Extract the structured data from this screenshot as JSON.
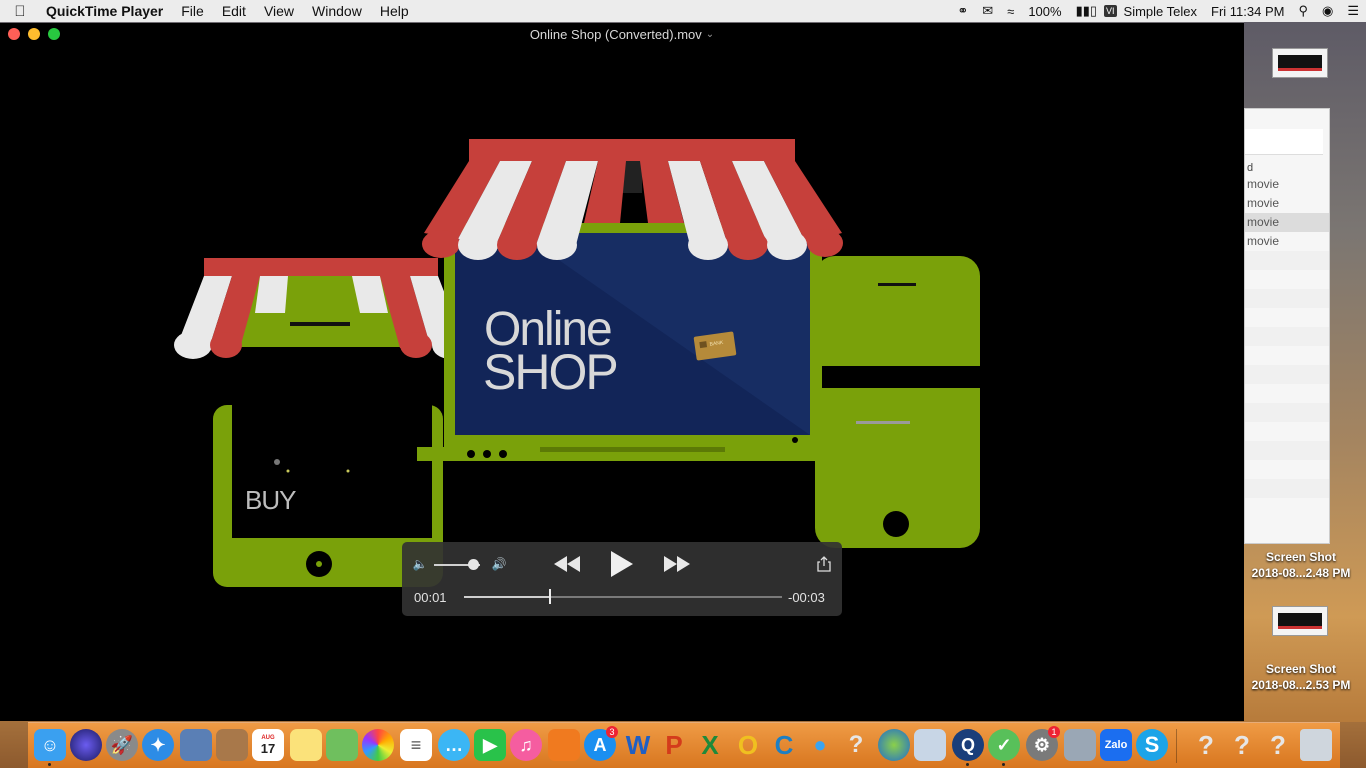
{
  "menubar": {
    "app_name": "QuickTime Player",
    "menus": [
      "File",
      "Edit",
      "View",
      "Window",
      "Help"
    ],
    "battery": "100%",
    "input_source": "Simple Telex",
    "clock": "Fri 11:34 PM"
  },
  "window": {
    "title": "Online Shop (Converted).mov"
  },
  "video": {
    "shop_word1": "Online",
    "shop_word2": "SHOP",
    "buy_label": "BUY",
    "card_label": "BANK"
  },
  "player": {
    "elapsed": "00:01",
    "remaining": "-00:03",
    "progress": 0.27,
    "volume": 0.85
  },
  "desktop": {
    "screenshot_1_name": "Screen Shot",
    "screenshot_1_date": "2018-08...2.48 PM",
    "screenshot_2_name": "Screen Shot",
    "screenshot_2_date": "2018-08...2.53 PM",
    "panel_rows": [
      "movie",
      "movie",
      "movie",
      "movie"
    ]
  },
  "dock": {
    "calendar_month": "AUG",
    "calendar_day": "17",
    "appstore_badge": "3",
    "prefs_badge": "1"
  },
  "colors": {
    "awning_red": "#c6403b",
    "awning_white": "#e9e9e9",
    "device_green": "#7aa10a",
    "screen_navy": "#122558"
  }
}
